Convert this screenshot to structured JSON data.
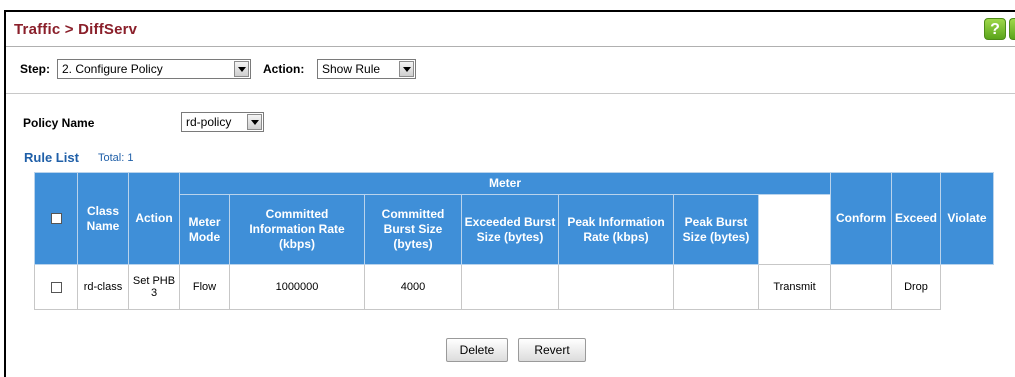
{
  "breadcrumb": {
    "text": "Traffic > DiffServ"
  },
  "help": {
    "label": "?"
  },
  "step": {
    "label": "Step:",
    "value": "2. Configure Policy"
  },
  "action": {
    "label": "Action:",
    "value": "Show Rule"
  },
  "policy": {
    "label": "Policy Name",
    "value": "rd-policy"
  },
  "rule_list": {
    "title": "Rule List",
    "total": "Total: 1"
  },
  "table": {
    "headers": {
      "class_name": "Class Name",
      "action": "Action",
      "meter_group": "Meter",
      "meter_mode": "Meter Mode",
      "cir": "Committed Information Rate (kbps)",
      "cbs": "Committed Burst Size (bytes)",
      "ebs": "Exceeded Burst Size (bytes)",
      "pir": "Peak Information Rate (kbps)",
      "pbs": "Peak Burst Size (bytes)",
      "conform": "Conform",
      "exceed": "Exceed",
      "violate": "Violate"
    },
    "rows": [
      {
        "class_name": "rd-class",
        "action": "Set PHB 3",
        "meter_mode": "Flow",
        "cir": "1000000",
        "cbs": "4000",
        "ebs": "",
        "pir": "",
        "pbs": "",
        "conform": "Transmit",
        "exceed": "",
        "violate": "Drop"
      }
    ]
  },
  "buttons": {
    "delete": "Delete",
    "revert": "Revert"
  },
  "colors": {
    "title": "#8a1f2a",
    "header": "#3f8fd8",
    "link": "#1f5fa8"
  }
}
